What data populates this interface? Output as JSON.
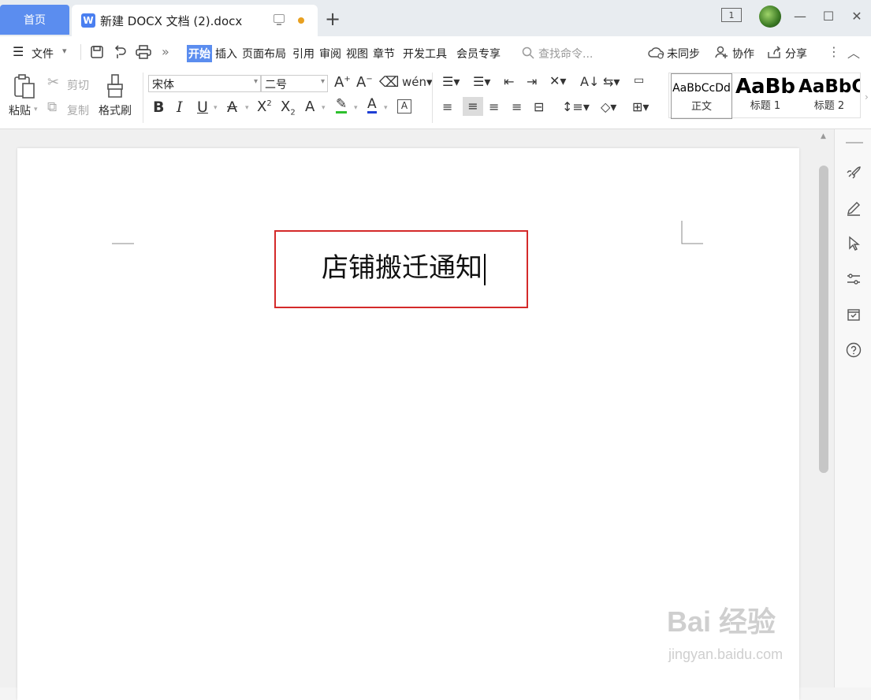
{
  "tabs": {
    "home": "首页",
    "document": "新建 DOCX 文档 (2).docx",
    "doc_icon_letter": "W"
  },
  "window": {
    "badge": "1"
  },
  "menu": {
    "file": "文件",
    "items": [
      "开始",
      "插入",
      "页面布局",
      "引用",
      "审阅",
      "视图",
      "章节",
      "开发工具",
      "会员专享"
    ],
    "active": "开始",
    "search_placeholder": "查找命令...",
    "unsynced": "未同步",
    "collaborate": "协作",
    "share": "分享"
  },
  "ribbon": {
    "paste": "粘贴",
    "cut": "剪切",
    "copy": "复制",
    "format_painter": "格式刷",
    "font_name": "宋体",
    "font_size": "二号",
    "styles": [
      {
        "sample": "AaBbCcDd",
        "label": "正文"
      },
      {
        "sample": "AaBb",
        "label": "标题 1"
      },
      {
        "sample": "AaBbC",
        "label": "标题 2"
      }
    ]
  },
  "document": {
    "title_text": "店铺搬迁通知"
  },
  "watermark": {
    "line1": "Bai 经验",
    "line2": "jingyan.baidu.com"
  },
  "colors": {
    "accent": "#5b8def",
    "title_box_border": "#d42a2a",
    "highlight_green": "#2ec02e",
    "font_color_blue": "#1f3fd4"
  }
}
